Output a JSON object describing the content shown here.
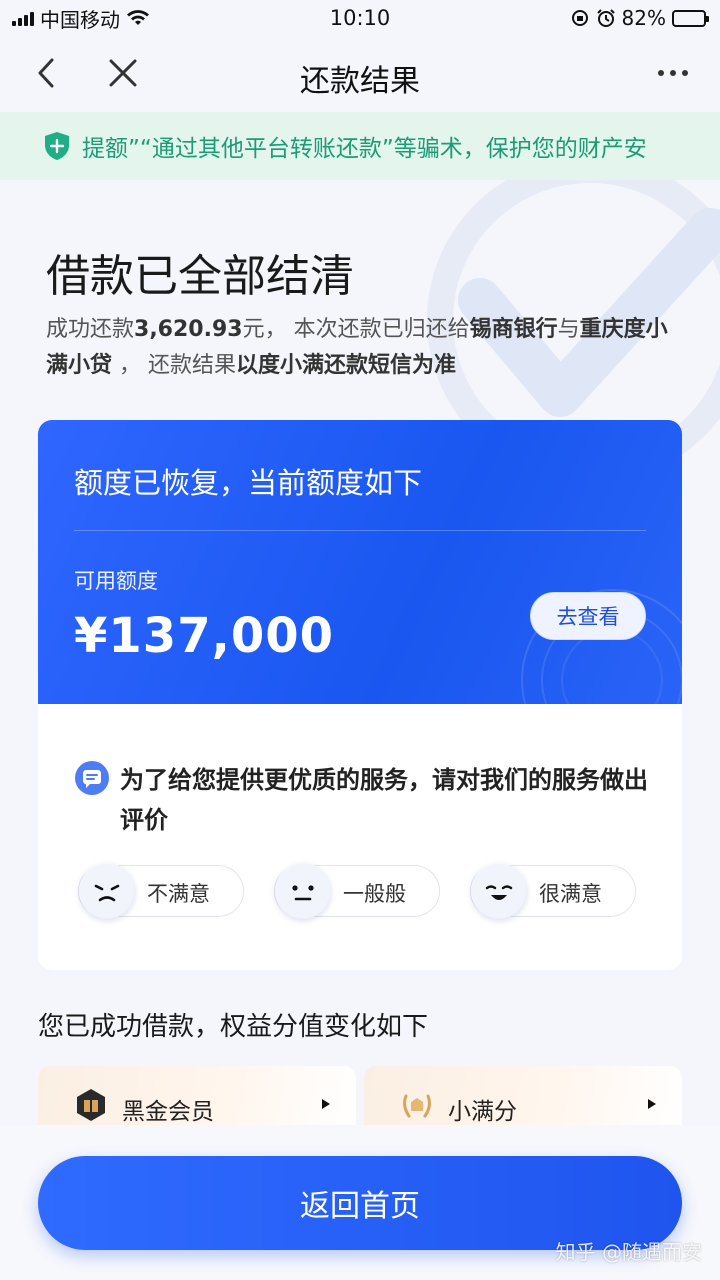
{
  "status_bar": {
    "carrier": "中国移动",
    "time": "10:10",
    "battery": "82%",
    "battery_level": 0.82
  },
  "nav": {
    "title": "还款结果"
  },
  "notice": {
    "text": "提额”“通过其他平台转账还款”等骗术，保护您的财产安"
  },
  "result": {
    "title": "借款已全部结清",
    "sub_1": "成功还款",
    "amount": "3,620.93",
    "sub_2": "元，  本次还款已归还给",
    "lender_1": "锡商银行",
    "sub_3": "与",
    "lender_2": "重庆度小满小贷",
    "sub_4": " ，  还款结果",
    "sub_5": "以度小满还款短信为准"
  },
  "credit_card": {
    "heading": "额度已恢复，当前额度如下",
    "label": "可用额度",
    "amount": "¥137,000",
    "button": "去查看"
  },
  "survey": {
    "question": "为了给您提供更优质的服务，请对我们的服务做出评价",
    "options": [
      {
        "label": "不满意",
        "icon": "unhappy-face-icon"
      },
      {
        "label": "一般般",
        "icon": "neutral-face-icon"
      },
      {
        "label": "很满意",
        "icon": "happy-face-icon"
      }
    ]
  },
  "benefits": {
    "title": "您已成功借款，权益分值变化如下",
    "items": [
      {
        "label": "黑金会员",
        "icon": "black-gold-member-icon"
      },
      {
        "label": "小满分",
        "icon": "laurel-score-icon"
      }
    ]
  },
  "footer": {
    "home_button": "返回首页",
    "watermark": "知乎 @随遇而安"
  },
  "colors": {
    "primary": "#2f66ff",
    "notice_bg": "#e4f5ee",
    "notice_text": "#1d9b76"
  }
}
